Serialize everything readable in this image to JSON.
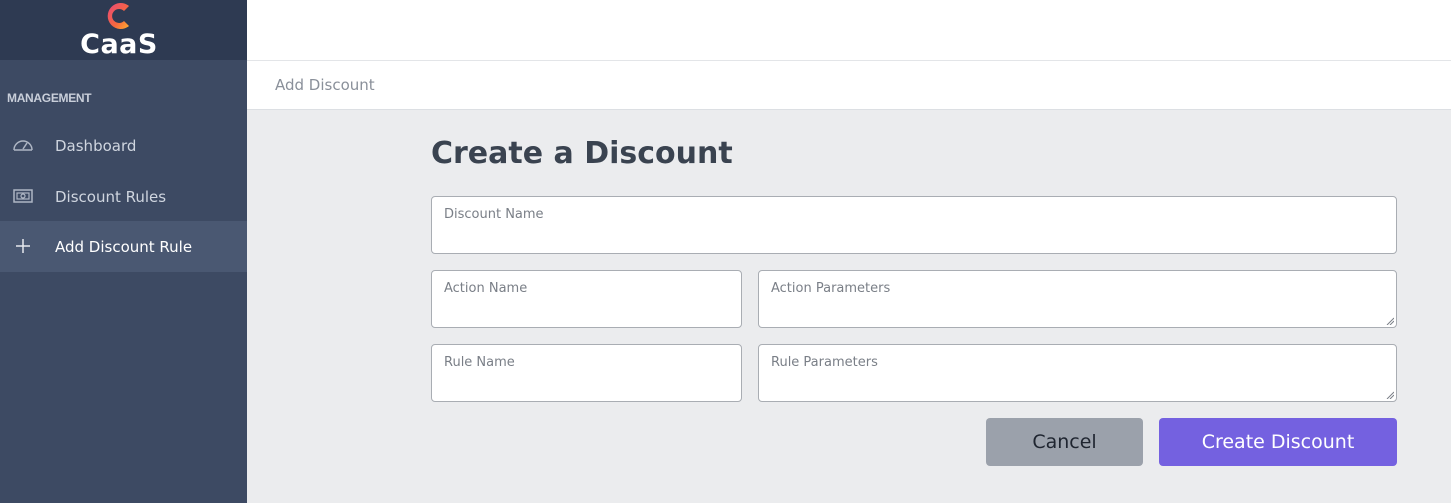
{
  "brand": {
    "name": "CaaS",
    "logo_letter": "C"
  },
  "sidebar": {
    "section_label": "MANAGEMENT",
    "items": [
      {
        "label": "Dashboard",
        "icon": "gauge-icon",
        "active": false
      },
      {
        "label": "Discount Rules",
        "icon": "money-bill-icon",
        "active": false
      },
      {
        "label": "Add Discount Rule",
        "icon": "plus-icon",
        "active": true
      }
    ]
  },
  "breadcrumb": "Add Discount",
  "main": {
    "title": "Create a Discount",
    "fields": {
      "discount_name": {
        "label": "Discount Name",
        "value": ""
      },
      "action_name": {
        "label": "Action Name",
        "value": ""
      },
      "action_parameters": {
        "label": "Action Parameters",
        "value": ""
      },
      "rule_name": {
        "label": "Rule Name",
        "value": ""
      },
      "rule_parameters": {
        "label": "Rule Parameters",
        "value": ""
      }
    },
    "buttons": {
      "cancel": "Cancel",
      "create": "Create Discount"
    }
  },
  "colors": {
    "sidebar_bg": "#3d4a63",
    "brand_bg": "#2e3a52",
    "active_item_bg": "#4a5872",
    "primary": "#7461e0",
    "secondary": "#9ba1ab",
    "content_bg": "#ebecee"
  }
}
